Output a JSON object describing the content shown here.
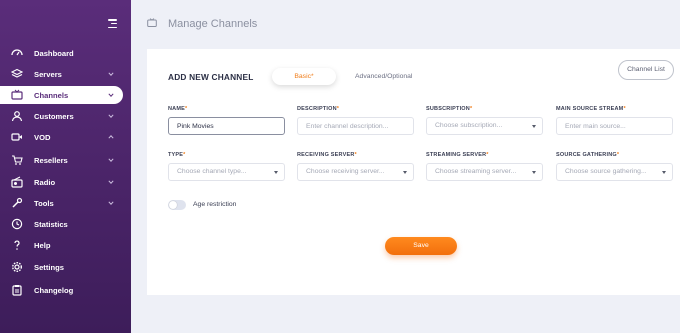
{
  "header": {
    "title": "Manage Channels",
    "icon": "tv-icon"
  },
  "sidebar": {
    "items": [
      {
        "label": "Dashboard",
        "icon": "dashboard-icon",
        "chevron": ""
      },
      {
        "label": "Servers",
        "icon": "layers-icon",
        "chevron": "down"
      },
      {
        "label": "Channels",
        "icon": "tv-icon",
        "chevron": "down",
        "active": true
      },
      {
        "label": "Customers",
        "icon": "user-icon",
        "chevron": "down"
      },
      {
        "label": "VOD",
        "icon": "video-icon",
        "chevron": "up"
      },
      {
        "label": "Resellers",
        "icon": "cart-icon",
        "chevron": "down"
      },
      {
        "label": "Radio",
        "icon": "radio-icon",
        "chevron": "down"
      },
      {
        "label": "Tools",
        "icon": "wrench-icon",
        "chevron": "down"
      },
      {
        "label": "Statistics",
        "icon": "clock-icon",
        "chevron": ""
      },
      {
        "label": "Help",
        "icon": "help-icon",
        "chevron": ""
      },
      {
        "label": "Settings",
        "icon": "gear-icon",
        "chevron": ""
      },
      {
        "label": "Changelog",
        "icon": "clipboard-icon",
        "chevron": ""
      }
    ]
  },
  "card": {
    "title": "ADD NEW CHANNEL",
    "tabs": {
      "basic": "Basic",
      "basic_req": "*",
      "advanced": "Advanced/Optional"
    },
    "channel_list_button": "Channel List",
    "fields": {
      "name": {
        "label": "NAME",
        "value": "Pink Movies"
      },
      "description": {
        "label": "DESCRIPTION",
        "placeholder": "Enter channel description..."
      },
      "subscription": {
        "label": "SUBSCRIPTION",
        "placeholder": "Choose subscription..."
      },
      "main_source": {
        "label": "MAIN SOURCE STREAM",
        "placeholder": "Enter main source..."
      },
      "type": {
        "label": "TYPE",
        "placeholder": "Choose channel type..."
      },
      "receiving_server": {
        "label": "RECEIVING SERVER",
        "placeholder": "Choose receiving server..."
      },
      "streaming_server": {
        "label": "STREAMING SERVER",
        "placeholder": "Choose streaming server..."
      },
      "source_gathering": {
        "label": "SOURCE GATHERING",
        "placeholder": "Choose source gathering..."
      }
    },
    "required_mark": "*",
    "age_restriction_label": "Age restriction",
    "save_label": "Save"
  },
  "colors": {
    "sidebar": "#4a2468",
    "accent": "#f07c18",
    "background": "#eef0f7"
  }
}
